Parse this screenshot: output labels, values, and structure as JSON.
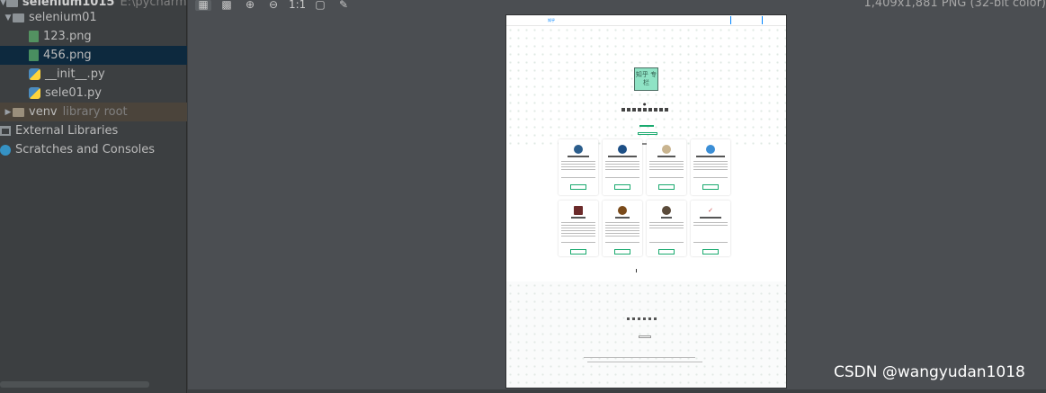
{
  "project_tree": {
    "root_label": "selenium1015",
    "root_path": "E:\\pycharm\\seleni",
    "items": [
      {
        "label": "selenium01",
        "kind": "folder",
        "depth": 1,
        "expanded": true
      },
      {
        "label": "123.png",
        "kind": "png",
        "depth": 2
      },
      {
        "label": "456.png",
        "kind": "png",
        "depth": 2,
        "selected": true
      },
      {
        "label": "__init__.py",
        "kind": "py",
        "depth": 2
      },
      {
        "label": "sele01.py",
        "kind": "py",
        "depth": 2
      },
      {
        "label": "venv",
        "suffix": "library root",
        "kind": "folder",
        "depth": 1,
        "expanded": false
      },
      {
        "label": "External Libraries",
        "kind": "lib",
        "depth": 0
      },
      {
        "label": "Scratches and Consoles",
        "kind": "scratch",
        "depth": 0
      }
    ]
  },
  "viewer": {
    "toolbar_icons": [
      "grid-icon",
      "chessboard-icon",
      "zoom-in-icon",
      "zoom-out-icon",
      "actual-size-icon",
      "fit-icon",
      "color-picker-icon"
    ],
    "image_info": "1,409x1,881 PNG (32-bit color)",
    "watermark": "CSDN @wangyudan1018"
  },
  "preview_page": {
    "brand": "知乎",
    "logo_text": "知乎 专栏",
    "accent": "#1aaa6f",
    "cards_row1": [
      {
        "avatar_color": "#2b5d8c"
      },
      {
        "avatar_color": "#1d4f86"
      },
      {
        "avatar_color": "#c9b48f"
      },
      {
        "avatar_color": "#3b8ed6"
      }
    ],
    "cards_row2": [
      {
        "avatar_color": "#6b2a2a"
      },
      {
        "avatar_color": "#7a4a1a"
      },
      {
        "avatar_color": "#5a4a3a"
      },
      {
        "avatar_color": "#c43a3a"
      }
    ]
  }
}
